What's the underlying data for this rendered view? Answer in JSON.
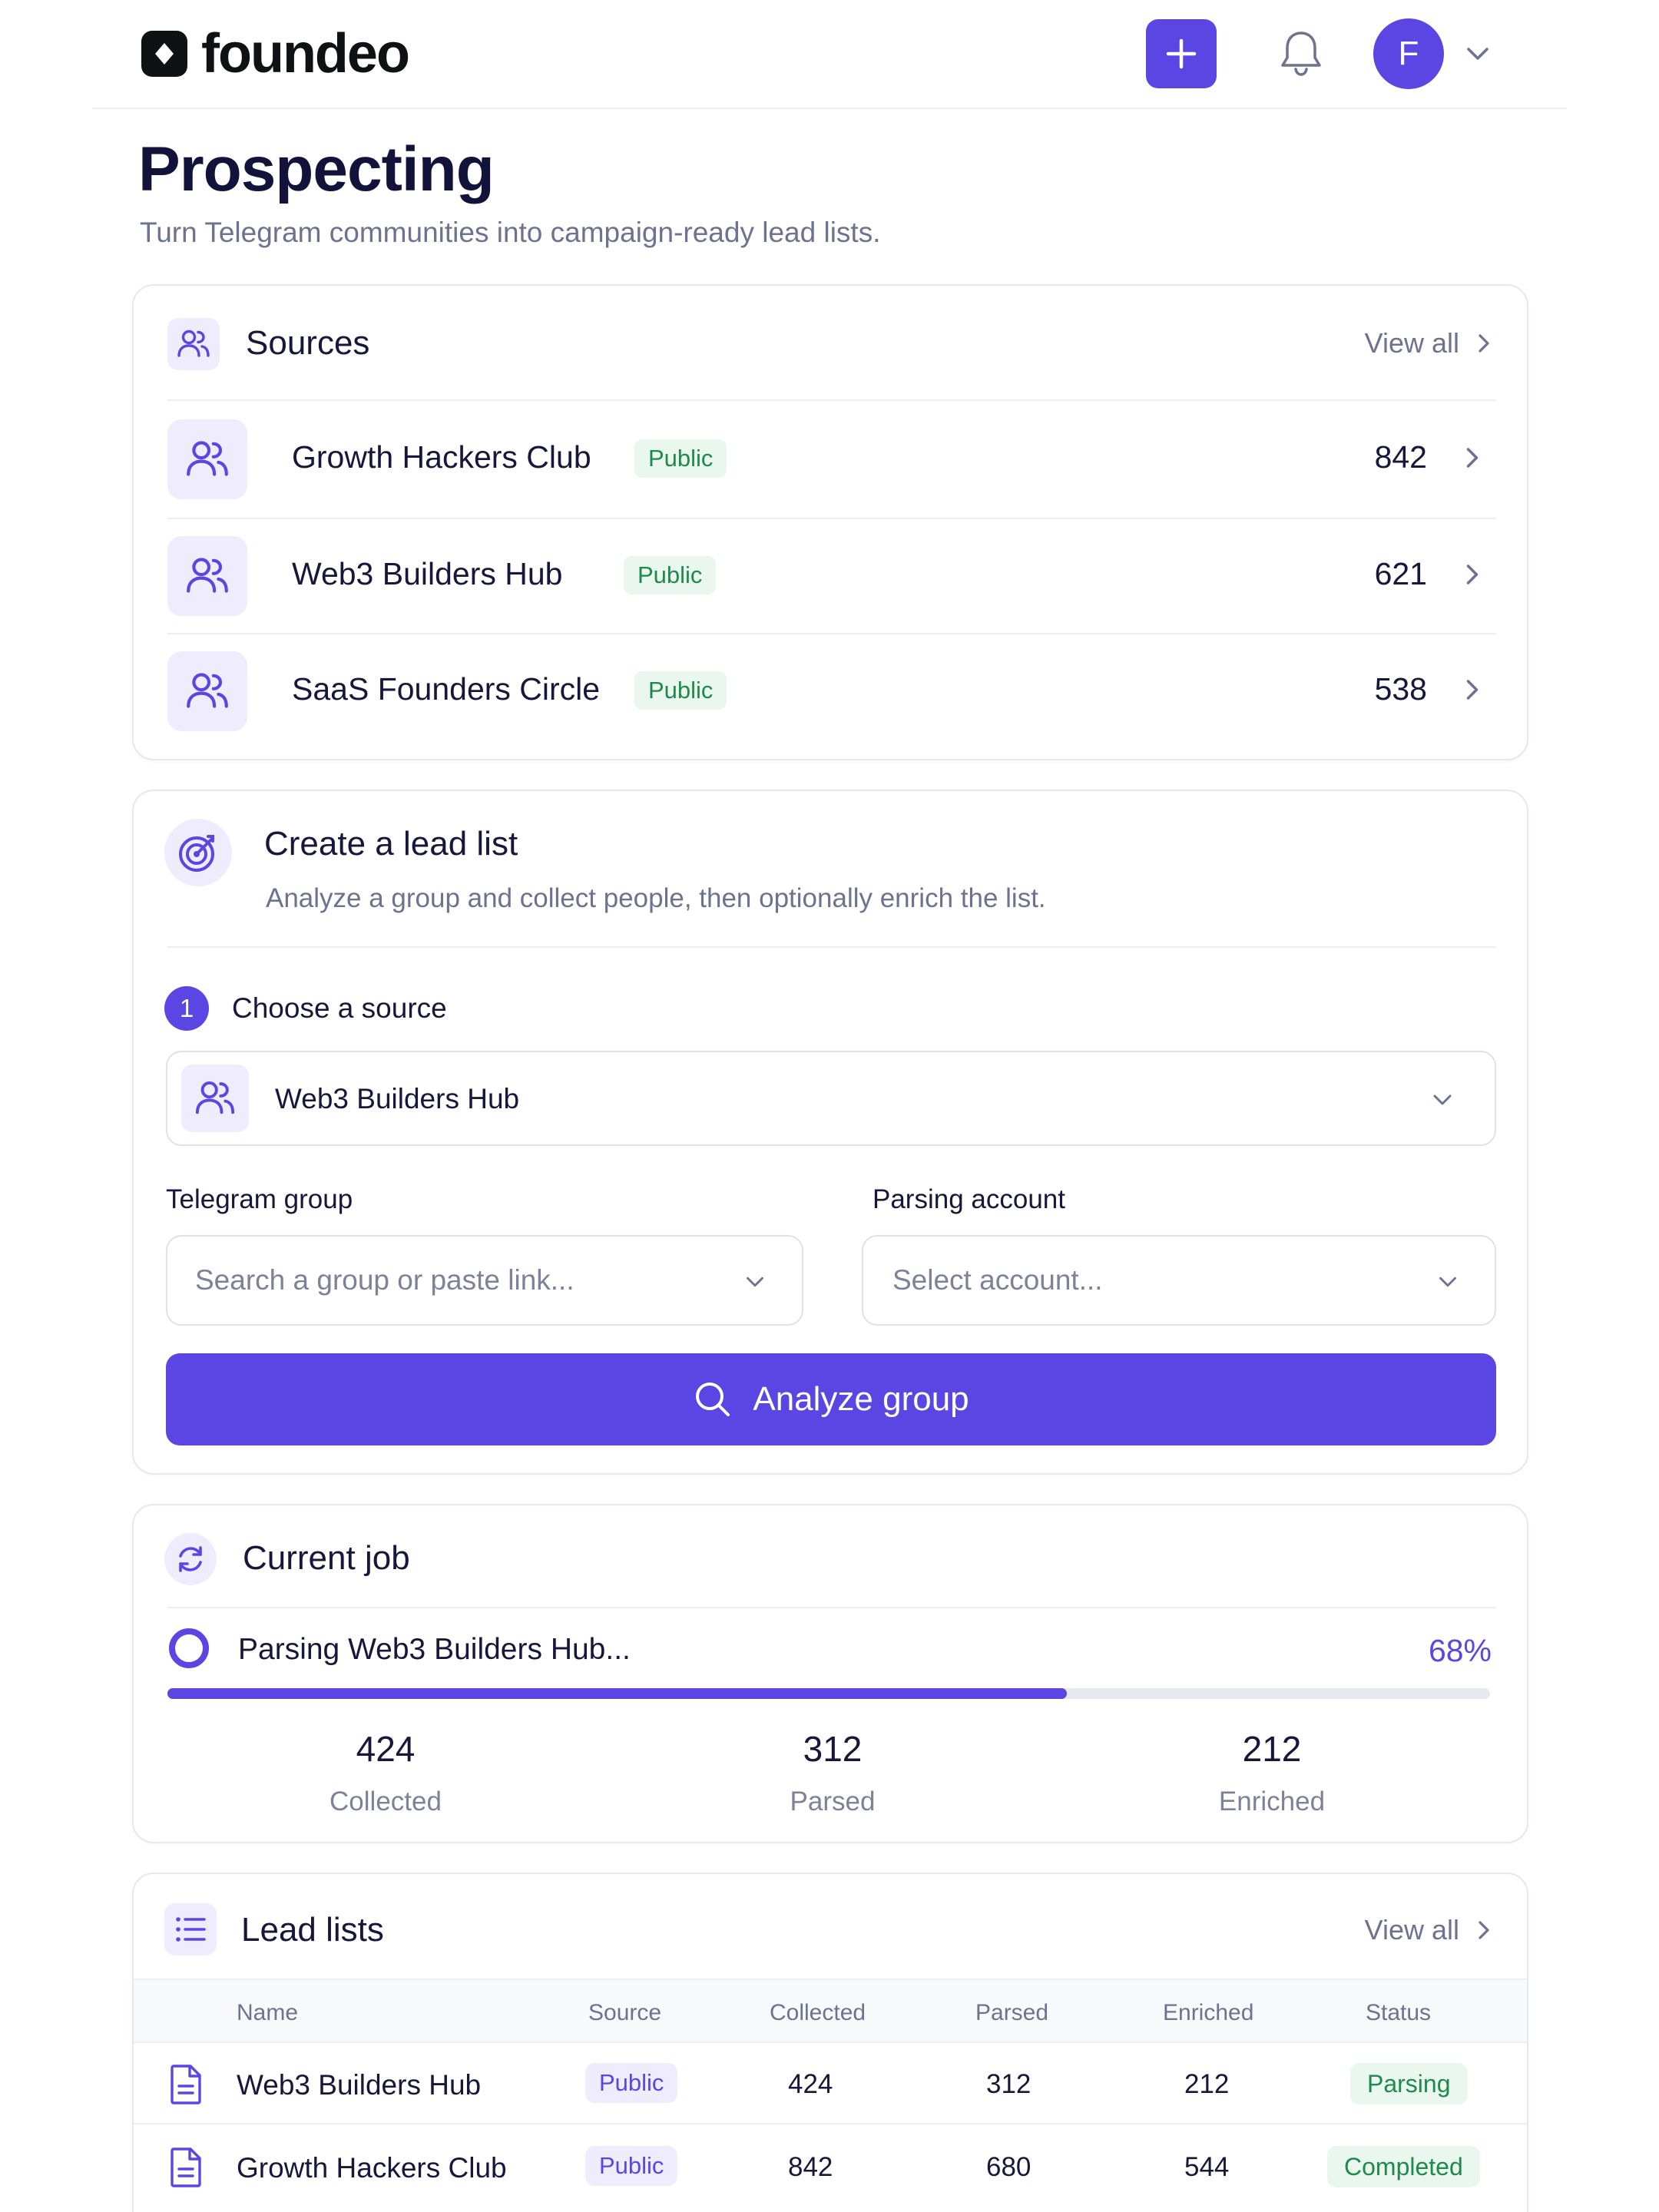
{
  "brand": {
    "name": "foundeo",
    "accent": "#5b45e3"
  },
  "header": {
    "avatar_initial": "F"
  },
  "page": {
    "title": "Prospecting",
    "subtitle": "Turn Telegram communities into campaign-ready lead lists."
  },
  "sources": {
    "title": "Sources",
    "view_all": "View all",
    "items": [
      {
        "name": "Growth Hackers Club",
        "badge": "Public",
        "count": "842"
      },
      {
        "name": "Web3 Builders Hub",
        "badge": "Public",
        "count": "621"
      },
      {
        "name": "SaaS Founders Circle",
        "badge": "Public",
        "count": "538"
      }
    ]
  },
  "create": {
    "title": "Create a lead list",
    "subtitle": "Analyze a group and collect people, then optionally enrich the list.",
    "step_number": "1",
    "step_label": "Choose a source",
    "selected_source": "Web3 Builders Hub",
    "telegram_label": "Telegram group",
    "telegram_placeholder": "Search a group or paste link...",
    "account_label": "Parsing account",
    "account_placeholder": "Select account...",
    "button": "Analyze group"
  },
  "job": {
    "title": "Current job",
    "status": "Parsing Web3 Builders Hub...",
    "percent_label": "68%",
    "progress": 0.68,
    "stats": [
      {
        "value": "424",
        "label": "Collected"
      },
      {
        "value": "312",
        "label": "Parsed"
      },
      {
        "value": "212",
        "label": "Enriched"
      }
    ]
  },
  "leads": {
    "title": "Lead lists",
    "view_all": "View all",
    "columns": [
      "Name",
      "Source",
      "Collected",
      "Parsed",
      "Enriched",
      "Status"
    ],
    "rows": [
      {
        "name": "Web3 Builders Hub",
        "source": "Public",
        "collected": "424",
        "parsed": "312",
        "enriched": "212",
        "status": "Parsing"
      },
      {
        "name": "Growth Hackers Club",
        "source": "Public",
        "collected": "842",
        "parsed": "680",
        "enriched": "544",
        "status": "Completed"
      }
    ]
  }
}
